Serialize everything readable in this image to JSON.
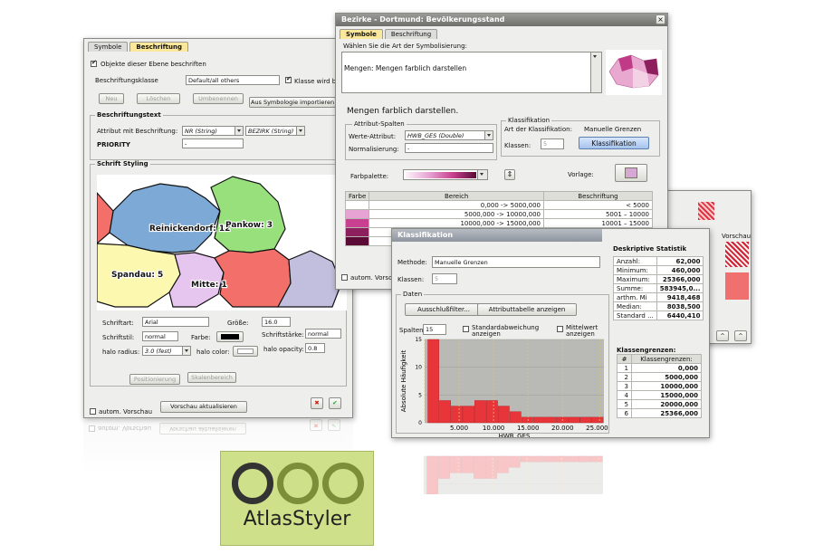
{
  "left_window": {
    "tabs": [
      {
        "label": "Symbole"
      },
      {
        "label": "Beschriftung"
      }
    ],
    "label_objects_checkbox": "Objekte dieser Ebene beschriften",
    "label_class_label": "Beschriftungsklasse",
    "label_class_value": "Default/all others",
    "class_labeled_checkbox": "Klasse wird beschr",
    "buttons": {
      "new": "Neu",
      "delete": "Löschen",
      "rename": "Umbenennen",
      "import": "Aus Symbologie importieren"
    },
    "label_text_header": "Beschriftungstext",
    "attr_label": "Attribut mit Beschriftung:",
    "attr1": "NR (String)",
    "attr2": "BEZIRK (String)",
    "priority_label": "PRIORITY",
    "priority_value": "-",
    "font_styling_header": "Schrift Styling",
    "map_labels": {
      "reinickendorf": "Reinickendorf: 12",
      "pankow": "Pankow: 3",
      "spandau": "Spandau: 5",
      "mitte": "Mitte: 1"
    },
    "font_label": "Schriftart:",
    "font_value": "Arial",
    "size_label": "Größe:",
    "size_value": "16.0",
    "style_label": "Schriftstil:",
    "style_value": "normal",
    "color_label": "Farbe:",
    "weight_label": "Schriftstärke:",
    "weight_value": "normal",
    "halo_radius_label": "halo radius:",
    "halo_radius_value": "3.0 (fest)",
    "halo_color_label": "halo color:",
    "halo_opacity_label": "halo opacity:",
    "halo_opacity_value": "0.8",
    "positioning_button": "Positionierung",
    "scale_range_button": "Skalenbereich",
    "auto_preview_checkbox": "autom. Vorschau",
    "update_preview_button": "Vorschau aktualisieren",
    "reflect_preview": "autom. Vorschau"
  },
  "middle_window": {
    "title": "Bezirke - Dortmund: Bevölkerungsstand",
    "tabs": [
      {
        "label": "Symbole"
      },
      {
        "label": "Beschriftung"
      }
    ],
    "choose_label": "Wählen Sie die Art der Symbolisierung:",
    "choose_value": "Mengen: Mengen farblich darstellen",
    "section_title": "Mengen farblich darstellen.",
    "attr_columns_header": "Attribut-Spalten",
    "value_attr_label": "Werte-Attribut:",
    "value_attr_value": "HWB_GES (Double)",
    "normalization_label": "Normalisierung:",
    "normalization_value": "-",
    "classification_header": "Klassifikation",
    "class_type_label": "Art der Klassifikation:",
    "class_type_value": "Manuelle Grenzen",
    "classes_label": "Klassen:",
    "classes_value": "5",
    "classification_button": "Klassifikation",
    "palette_label": "Farbpalette:",
    "template_label": "Vorlage:",
    "table_headers": [
      "Farbe",
      "Bereich",
      "Beschriftung"
    ],
    "rows": [
      {
        "color": "#ffffff",
        "range": "0,000 -> 5000,000",
        "label": "< 5000"
      },
      {
        "color": "#e6a3d3",
        "range": "5000,000 -> 10000,000",
        "label": "5001 – 10000"
      },
      {
        "color": "#c8408f",
        "range": "10000,000 -> 15000,000",
        "label": "10001 – 15000"
      },
      {
        "color": "#8e1f5f",
        "range": "",
        "label": ""
      },
      {
        "color": "#5a0a35",
        "range": "",
        "label": ""
      }
    ],
    "auto_preview_checkbox": "autom. Vorsc"
  },
  "class_window": {
    "title": "Klassifikation",
    "method_label": "Methode:",
    "method_value": "Manuelle Grenzen",
    "classes_label": "Klassen:",
    "classes_value": "5",
    "data_header": "Daten",
    "exclusion_button": "Ausschlußfilter...",
    "attr_table_button": "Attributtabelle anzeigen",
    "columns_label": "Spalten:",
    "columns_value": "15",
    "std_checkbox": "Standardabweichung anzeigen",
    "mean_checkbox": "Mittelwert anzeigen",
    "stats_header": "Deskriptive Statistik",
    "stats": [
      {
        "label": "Anzahl:",
        "value": "62,000"
      },
      {
        "label": "Minimum:",
        "value": "460,000"
      },
      {
        "label": "Maximum:",
        "value": "25366,000"
      },
      {
        "label": "Summe:",
        "value": "583945,0..."
      },
      {
        "label": "arthm. Mi",
        "value": "9418,468"
      },
      {
        "label": "Median:",
        "value": "8038,500"
      },
      {
        "label": "Standard ...",
        "value": "6440,410"
      }
    ],
    "bounds_header": "Klassengrenzen:",
    "bounds_headers": [
      "#",
      "Klassengrenzen:"
    ],
    "bounds": [
      {
        "n": "1",
        "value": "0,000"
      },
      {
        "n": "2",
        "value": "5000,000"
      },
      {
        "n": "3",
        "value": "10000,000"
      },
      {
        "n": "4",
        "value": "15000,000"
      },
      {
        "n": "5",
        "value": "20000,000"
      },
      {
        "n": "6",
        "value": "25366,000"
      }
    ]
  },
  "right_window": {
    "header": "Vorschau"
  },
  "chart_data": {
    "type": "bar",
    "title": "",
    "xlabel": "HWB_GES",
    "ylabel": "Absolute Häufigkeit",
    "x_ticks": [
      "5.000",
      "10.000",
      "15.000",
      "20.000",
      "25.000"
    ],
    "xlim": [
      0,
      26000
    ],
    "ylim": [
      0,
      15
    ],
    "bin_width": 1700,
    "bin_starts": [
      460,
      2160,
      3860,
      5560,
      7260,
      8960,
      10660,
      12360,
      14060,
      15760,
      17460,
      19160,
      20860,
      22560,
      24260
    ],
    "values": [
      15,
      4,
      3,
      3,
      4,
      4,
      3,
      2,
      1,
      1,
      1,
      1,
      1,
      1,
      1
    ],
    "class_bounds": [
      0,
      5000,
      10000,
      15000,
      20000,
      25366
    ],
    "bar_color": "#e8353a",
    "grid": true
  },
  "logo": {
    "text": "AtlasStyler"
  }
}
